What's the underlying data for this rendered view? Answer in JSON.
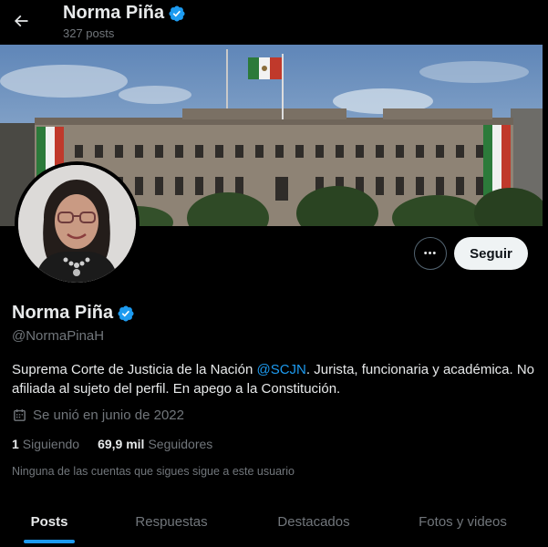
{
  "header": {
    "name": "Norma Piña",
    "posts_count": "327 posts"
  },
  "profile": {
    "display_name": "Norma Piña",
    "handle": "@NormaPinaH",
    "bio_before": "Suprema Corte de Justicia de la Nación ",
    "bio_link": "@SCJN",
    "bio_after": ". Jurista, funcionaria y académica. No afiliada al sujeto del perfil. En apego a la Constitución.",
    "joined": "Se unió en junio de 2022"
  },
  "actions": {
    "more_label": "•••",
    "follow_label": "Seguir"
  },
  "stats": {
    "following_count": "1",
    "following_label": "Siguiendo",
    "followers_count": "69,9 mil",
    "followers_label": "Seguidores"
  },
  "followers_you_know": "Ninguna de las cuentas que sigues sigue a este usuario",
  "tabs": [
    {
      "label": "Posts",
      "active": true
    },
    {
      "label": "Respuestas",
      "active": false
    },
    {
      "label": "Destacados",
      "active": false
    },
    {
      "label": "Fotos y videos",
      "active": false
    }
  ],
  "colors": {
    "accent": "#1d9bf0",
    "background": "#000000",
    "text_primary": "#e7e9ea",
    "text_secondary": "#71767b"
  }
}
